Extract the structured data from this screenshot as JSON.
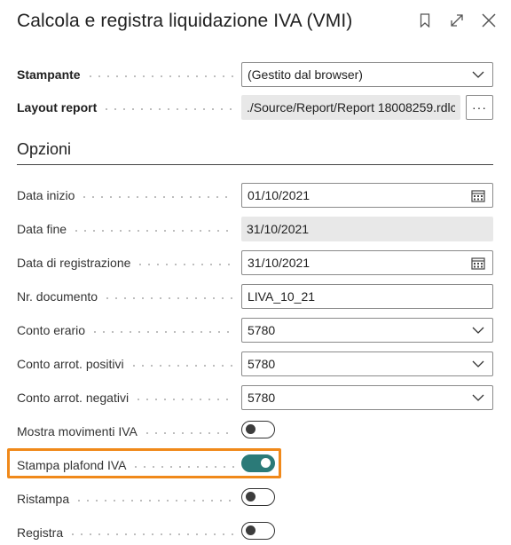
{
  "dialog": {
    "title": "Calcola e registra liquidazione IVA (VMI)",
    "icons": [
      "bookmark-icon",
      "expand-icon",
      "close-icon"
    ]
  },
  "fields": {
    "stampante": {
      "label": "Stampante",
      "value": "(Gestito dal browser)"
    },
    "layout_report": {
      "label": "Layout report",
      "value": "./Source/Report/Report 18008259.rdlc",
      "button": "···"
    }
  },
  "options": {
    "heading": "Opzioni",
    "data_inizio": {
      "label": "Data inizio",
      "value": "01/10/2021"
    },
    "data_fine": {
      "label": "Data fine",
      "value": "31/10/2021"
    },
    "data_registrazione": {
      "label": "Data di registrazione",
      "value": "31/10/2021"
    },
    "nr_documento": {
      "label": "Nr. documento",
      "value": "LIVA_10_21"
    },
    "conto_erario": {
      "label": "Conto erario",
      "value": "5780"
    },
    "conto_arrot_positivi": {
      "label": "Conto arrot. positivi",
      "value": "5780"
    },
    "conto_arrot_negativi": {
      "label": "Conto arrot. negativi",
      "value": "5780"
    },
    "mostra_movimenti_iva": {
      "label": "Mostra movimenti IVA",
      "checked": false
    },
    "stampa_plafond_iva": {
      "label": "Stampa plafond IVA",
      "checked": true
    },
    "ristampa": {
      "label": "Ristampa",
      "checked": false
    },
    "registra": {
      "label": "Registra",
      "checked": false
    }
  },
  "colors": {
    "accent": "#2b7a78",
    "highlight": "#f0891a",
    "readonly_bg": "#e8e8e8"
  }
}
